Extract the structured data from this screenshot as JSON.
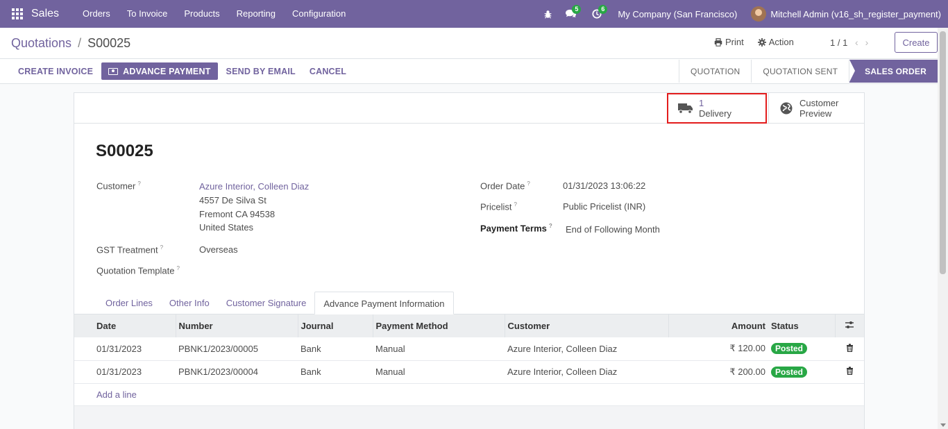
{
  "navbar": {
    "app_name": "Sales",
    "menu": [
      "Orders",
      "To Invoice",
      "Products",
      "Reporting",
      "Configuration"
    ],
    "messages_count": "5",
    "activities_count": "6",
    "company": "My Company (San Francisco)",
    "user": "Mitchell Admin (v16_sh_register_payment)",
    "color": "#71639e"
  },
  "control": {
    "breadcrumb_parent": "Quotations",
    "breadcrumb_sep": "/",
    "breadcrumb_current": "S00025",
    "print_label": "Print",
    "action_label": "Action",
    "pager": "1 / 1",
    "create_label": "Create"
  },
  "statusbar": {
    "buttons": [
      "CREATE INVOICE",
      "ADVANCE PAYMENT",
      "SEND BY EMAIL",
      "CANCEL"
    ],
    "stages": [
      "QUOTATION",
      "QUOTATION SENT",
      "SALES ORDER"
    ],
    "active_stage": "SALES ORDER"
  },
  "smart_buttons": {
    "delivery_count": "1",
    "delivery_label": "Delivery",
    "preview_line1": "Customer",
    "preview_line2": "Preview"
  },
  "record": {
    "name": "S00025",
    "customer_label": "Customer",
    "customer_name": "Azure Interior, Colleen Diaz",
    "address_line1": "4557 De Silva St",
    "address_line2": "Fremont CA 94538",
    "address_line3": "United States",
    "gst_label": "GST Treatment",
    "gst_value": "Overseas",
    "template_label": "Quotation Template",
    "order_date_label": "Order Date",
    "order_date": "01/31/2023 13:06:22",
    "pricelist_label": "Pricelist",
    "pricelist": "Public Pricelist (INR)",
    "payment_terms_label": "Payment Terms",
    "payment_terms": "End of Following Month",
    "help_mark": "?"
  },
  "tabs": [
    "Order Lines",
    "Other Info",
    "Customer Signature",
    "Advance Payment Information"
  ],
  "active_tab": "Advance Payment Information",
  "payments": {
    "headers": [
      "Date",
      "Number",
      "Journal",
      "Payment Method",
      "Customer",
      "Amount",
      "Status"
    ],
    "rows": [
      {
        "date": "01/31/2023",
        "number": "PBNK1/2023/00005",
        "journal": "Bank",
        "method": "Manual",
        "customer": "Azure Interior, Colleen Diaz",
        "amount": "₹ 120.00",
        "status": "Posted"
      },
      {
        "date": "01/31/2023",
        "number": "PBNK1/2023/00004",
        "journal": "Bank",
        "method": "Manual",
        "customer": "Azure Interior, Colleen Diaz",
        "amount": "₹ 200.00",
        "status": "Posted"
      }
    ],
    "add_line": "Add a line"
  }
}
